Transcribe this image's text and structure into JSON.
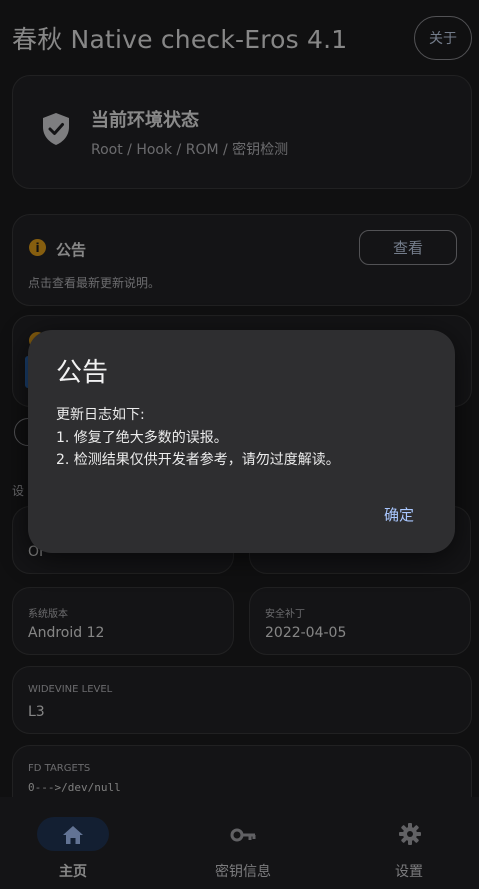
{
  "app": {
    "title": "春秋 Native check-Eros 4.1",
    "about_label": "关于"
  },
  "status_card": {
    "title": "当前环境状态",
    "subtitle": "Root / Hook / ROM / 密钥检测",
    "icon": "shield-check-icon"
  },
  "notice_card": {
    "title": "公告",
    "description": "点击查看最新更新说明。",
    "view_label": "查看"
  },
  "section_fragment": "设",
  "info_cards": {
    "partial_left_value": "OF",
    "system_version_label": "系统版本",
    "system_version_value": "Android 12",
    "security_patch_label": "安全补丁",
    "security_patch_value": "2022-04-05",
    "widevine_label": "WIDEVINE LEVEL",
    "widevine_value": "L3",
    "fd_targets_label": "FD TARGETS",
    "fd_targets_line1": "0--->/dev/null"
  },
  "dialog": {
    "title": "公告",
    "line1": "更新日志如下:",
    "line2": "1. 修复了绝大多数的误报。",
    "line3": "2. 检测结果仅供开发者参考，请勿过度解读。",
    "ok_label": "确定"
  },
  "bottom_nav": {
    "items": [
      {
        "label": "主页",
        "icon": "home-icon",
        "active": true
      },
      {
        "label": "密钥信息",
        "icon": "key-icon",
        "active": false
      },
      {
        "label": "设置",
        "icon": "gear-icon",
        "active": false
      }
    ]
  },
  "colors": {
    "background": "#1c1c1e",
    "card": "#242426",
    "accent": "#a9c7ff",
    "warning": "#e7a21a",
    "nav_active_pill": "#223656"
  }
}
